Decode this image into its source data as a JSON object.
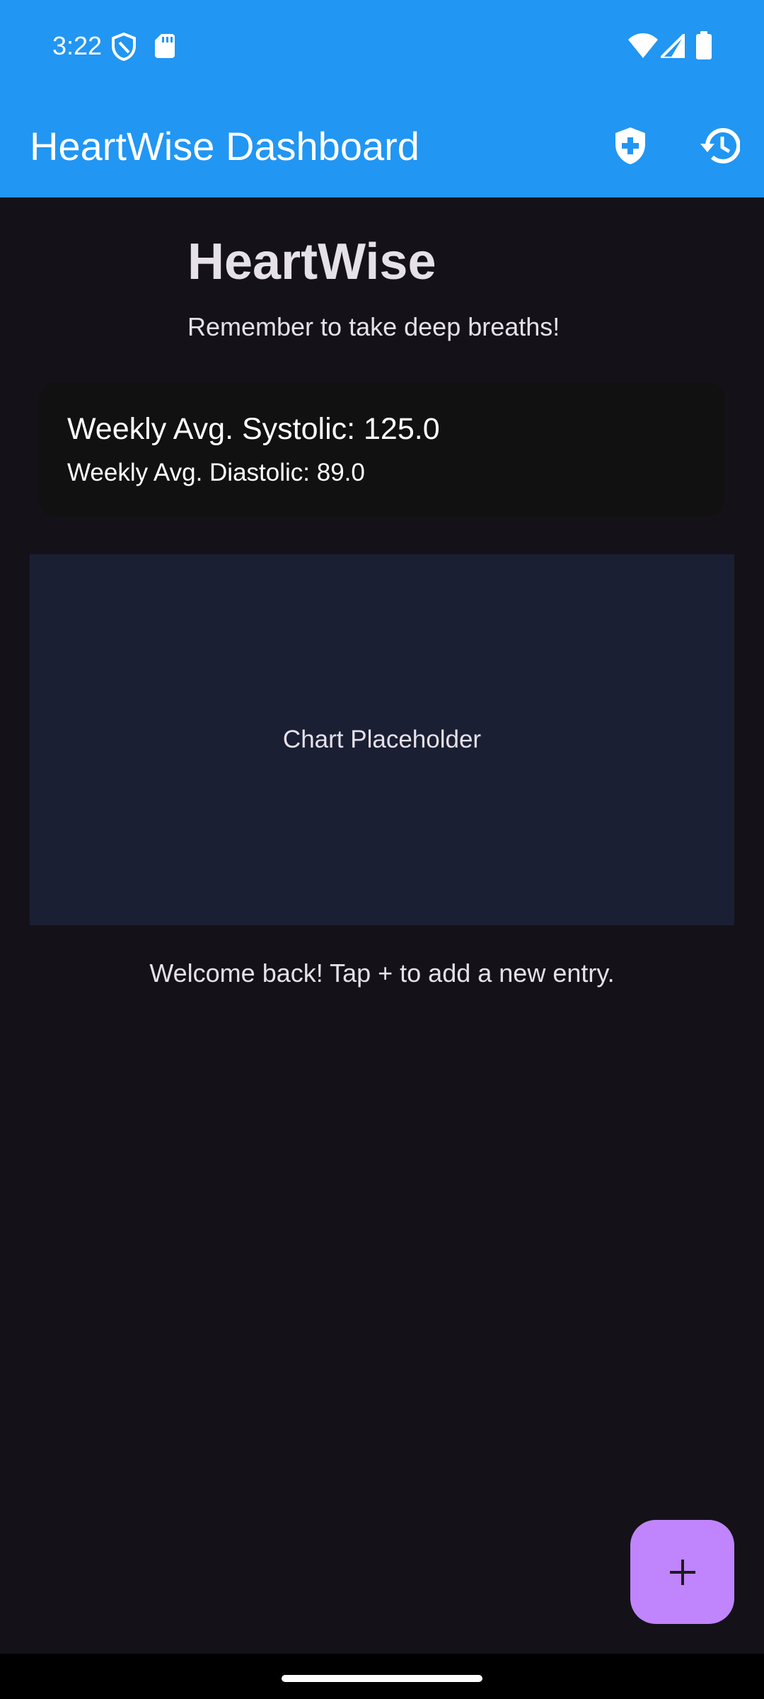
{
  "status_bar": {
    "time": "3:22",
    "icons_left": [
      "shield-icon",
      "sd-card-icon"
    ],
    "icons_right": [
      "wifi-icon",
      "cellular-signal-icon",
      "battery-icon"
    ]
  },
  "app_bar": {
    "title": "HeartWise Dashboard",
    "actions": [
      "health-shield-icon",
      "history-icon"
    ]
  },
  "header": {
    "title": "HeartWise",
    "subtitle": "Remember to take deep breaths!"
  },
  "averages": {
    "systolic": "Weekly Avg. Systolic: 125.0",
    "diastolic": "Weekly Avg. Diastolic: 89.0"
  },
  "chart": {
    "placeholder": "Chart Placeholder"
  },
  "welcome": "Welcome back! Tap + to add a new entry.",
  "fab": {
    "icon": "plus-icon"
  },
  "colors": {
    "primary": "#2196F3",
    "background": "#141218",
    "card": "#111111",
    "chart_bg": "#1A1F33",
    "fab": "#C084FC",
    "text": "#E6E0E9"
  }
}
